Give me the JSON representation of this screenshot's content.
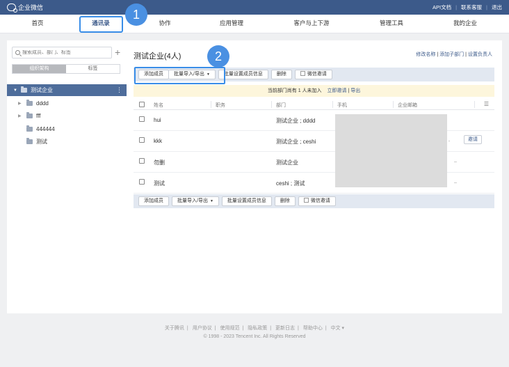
{
  "app": {
    "name": "企业微信"
  },
  "top_links": [
    "API文档",
    "联系客服",
    "退出"
  ],
  "nav": [
    "首页",
    "通讯录",
    "协作",
    "应用管理",
    "客户与上下游",
    "管理工具",
    "我的企业"
  ],
  "steps": [
    "1",
    "2"
  ],
  "sidebar": {
    "search_placeholder": "搜索成员、部门、标签",
    "tabs": [
      "组织架构",
      "标签"
    ],
    "root": "测试企业",
    "items": [
      {
        "name": "dddd",
        "expandable": true
      },
      {
        "name": "fff",
        "expandable": true
      },
      {
        "name": "444444",
        "expandable": false
      },
      {
        "name": "测试",
        "expandable": false
      }
    ]
  },
  "main": {
    "title": "测试企业(4人)",
    "actions": [
      "修改名称",
      "添加子部门",
      "设置负责人"
    ],
    "toolbar": {
      "add": "添加成员",
      "import_export": "批量导入/导出",
      "batch_set": "批量设置成员信息",
      "delete": "删除",
      "wechat_invite": "微信邀请"
    },
    "notice": {
      "text": "当前部门尚有 1 人未加入",
      "invite": "立即邀请",
      "export": "导出"
    },
    "columns": [
      "姓名",
      "职务",
      "部门",
      "手机",
      "企业邮箱"
    ],
    "rows": [
      {
        "name": "hui",
        "dept": "测试企业 ; dddd",
        "trail": "",
        "invite": ""
      },
      {
        "name": "kkk",
        "dept": "测试企业 ; ceshi",
        "trail": ".",
        "invite": "邀请"
      },
      {
        "name": "勿删",
        "dept": "测试企业",
        "trail": "..",
        "invite": ""
      },
      {
        "name": "测试",
        "dept": "ceshi ; 测试",
        "trail": "..",
        "invite": ""
      }
    ]
  },
  "footer": {
    "links": [
      "关于腾讯",
      "用户协议",
      "使用规范",
      "隐私政策",
      "更新日志",
      "帮助中心",
      "中文 ▾"
    ],
    "copyright": "© 1998 - 2023 Tencent Inc. All Rights Reserved"
  },
  "colors": {
    "brand": "#3c5a8a",
    "highlight": "#3a8ee8",
    "step": "#4a90e2"
  }
}
